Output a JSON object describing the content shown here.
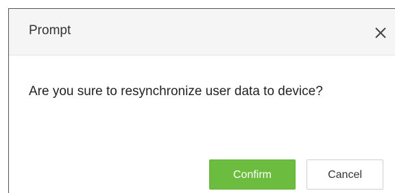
{
  "dialog": {
    "title": "Prompt",
    "close_icon": "close-icon",
    "message": "Are you sure to resynchronize user data to device?",
    "buttons": {
      "confirm_label": "Confirm",
      "cancel_label": "Cancel"
    }
  },
  "colors": {
    "header_bg": "#f5f5f5",
    "confirm_bg": "#6cbc3f",
    "confirm_text": "#ffffff",
    "cancel_border": "#cfcfcf",
    "text": "#333333"
  }
}
